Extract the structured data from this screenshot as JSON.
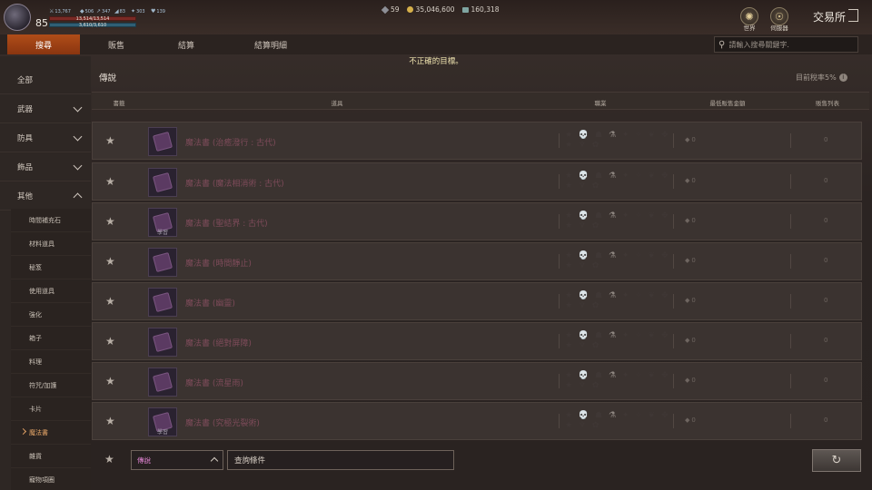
{
  "player": {
    "level": "85",
    "hp_text": "13,514/13,514",
    "mp_text": "3,610/3,610",
    "stats": [
      "13,767",
      "506",
      "347",
      "83",
      "303",
      "139"
    ]
  },
  "currencies": {
    "crystals": "59",
    "gold": "35,046,600",
    "silver": "160,318"
  },
  "top_icons": {
    "world_label": "世界",
    "server_label": "伺服器",
    "exchange_title": "交易所"
  },
  "tabs": [
    {
      "label": "搜尋"
    },
    {
      "label": "販售"
    },
    {
      "label": "結算"
    },
    {
      "label": "結算明細"
    }
  ],
  "search": {
    "placeholder": "請輸入搜尋關鍵字."
  },
  "error_message": "不正確的目標。",
  "sidebar": {
    "items": [
      {
        "label": "全部"
      },
      {
        "label": "武器"
      },
      {
        "label": "防具"
      },
      {
        "label": "飾品"
      },
      {
        "label": "其他"
      }
    ],
    "sub_items": [
      {
        "label": "時間補充石"
      },
      {
        "label": "材料道具"
      },
      {
        "label": "秘笈"
      },
      {
        "label": "使用道具"
      },
      {
        "label": "強化"
      },
      {
        "label": "箱子"
      },
      {
        "label": "料理"
      },
      {
        "label": "符咒/加護"
      },
      {
        "label": "卡片"
      },
      {
        "label": "魔法書"
      },
      {
        "label": "雜貨"
      },
      {
        "label": "寵物項圈"
      }
    ]
  },
  "panel": {
    "category_title": "傳說",
    "rate_text": "目前稅率5%",
    "rate_info": "i",
    "headers": {
      "favorite": "書籤",
      "item": "道具",
      "class": "職業",
      "min_price": "最低販售金額",
      "sales_list": "販售列表"
    }
  },
  "items": [
    {
      "name": "魔法書 (治癒潑行 : 古代)",
      "price": "0",
      "count": "0",
      "learn": ""
    },
    {
      "name": "魔法書 (魔法相消術 : 古代)",
      "price": "0",
      "count": "0",
      "learn": ""
    },
    {
      "name": "魔法書 (聖結界 : 古代)",
      "price": "0",
      "count": "0",
      "learn": "學習"
    },
    {
      "name": "魔法書 (時間靜止)",
      "price": "0",
      "count": "0",
      "learn": ""
    },
    {
      "name": "魔法書 (幽靈)",
      "price": "0",
      "count": "0",
      "learn": ""
    },
    {
      "name": "魔法書 (絕對屏障)",
      "price": "0",
      "count": "0",
      "learn": ""
    },
    {
      "name": "魔法書 (流星雨)",
      "price": "0",
      "count": "0",
      "learn": ""
    },
    {
      "name": "魔法書 (究極光裂術)",
      "price": "0",
      "count": "0",
      "learn": "學習"
    }
  ],
  "bottom": {
    "grade_value": "傳說",
    "query_value": "查詢條件",
    "refresh_icon": "refresh-icon"
  }
}
